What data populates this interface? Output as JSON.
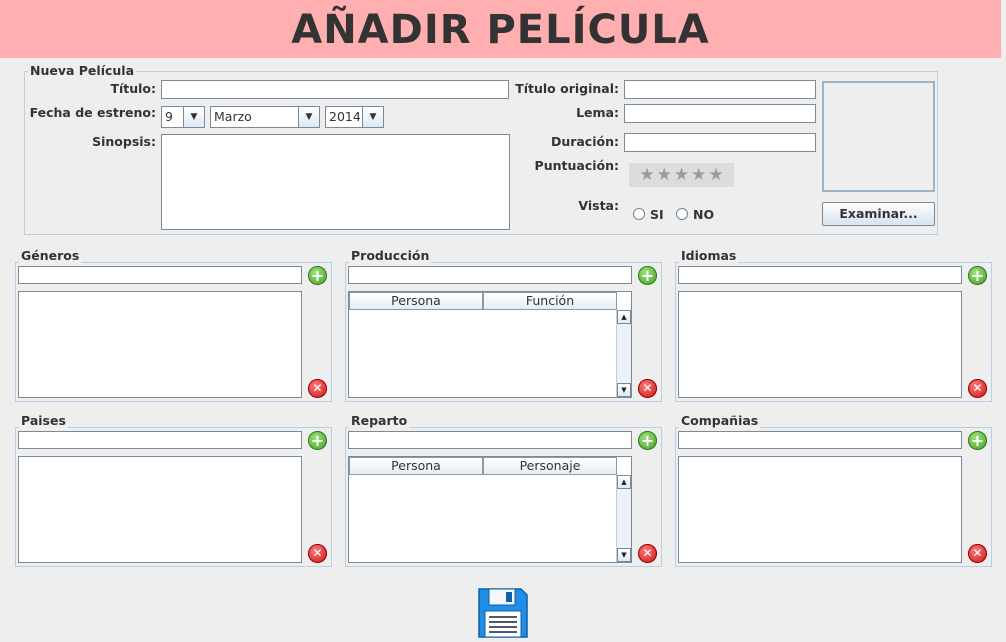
{
  "header": {
    "title": "AÑADIR PELÍCULA"
  },
  "nueva": {
    "legend": "Nueva Película",
    "titulo_label": "Título:",
    "titulo_value": "",
    "fecha_label": "Fecha de estreno:",
    "day": "9",
    "month": "Marzo",
    "year": "2014",
    "sinopsis_label": "Sinopsis:",
    "sinopsis_value": "",
    "titulo_original_label": "Título original:",
    "titulo_original_value": "",
    "lema_label": "Lema:",
    "lema_value": "",
    "duracion_label": "Duración:",
    "duracion_value": "",
    "puntuacion_label": "Puntuación:",
    "puntuacion_stars": 0,
    "vista_label": "Vista:",
    "vista_si": "SI",
    "vista_no": "NO",
    "examinar": "Examinar..."
  },
  "panels": {
    "generos": {
      "legend": "Géneros"
    },
    "produccion": {
      "legend": "Producción",
      "col1": "Persona",
      "col2": "Función"
    },
    "idiomas": {
      "legend": "Idiomas"
    },
    "paises": {
      "legend": "Paises"
    },
    "reparto": {
      "legend": "Reparto",
      "col1": "Persona",
      "col2": "Personaje"
    },
    "companias": {
      "legend": "Compañias"
    }
  },
  "icons": {
    "add": "plus-circle-icon",
    "delete": "x-circle-icon",
    "save": "floppy-disk-icon"
  },
  "colors": {
    "header_bg": "#ffafaf",
    "add_green": "#3f9a22",
    "delete_red": "#c40f0f",
    "save_blue": "#1e8ee8"
  }
}
